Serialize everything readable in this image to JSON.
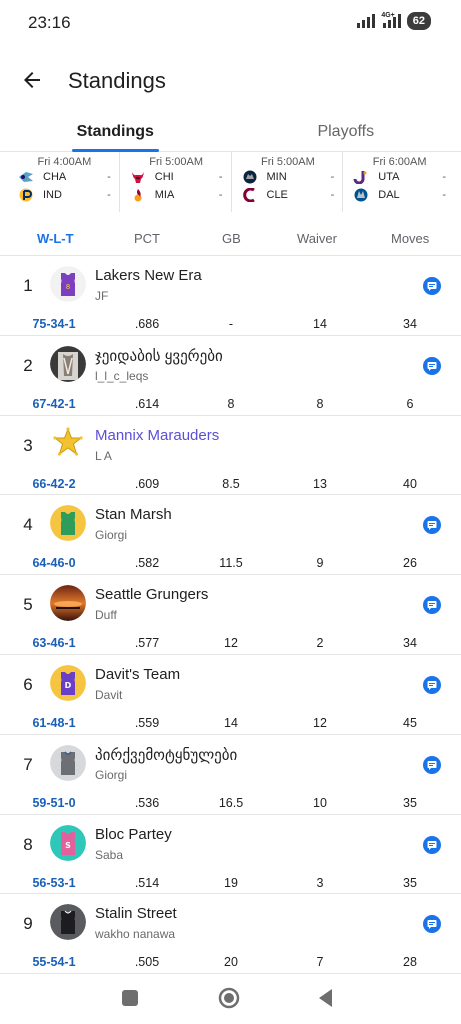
{
  "status": {
    "time": "23:16",
    "network": "4G+",
    "battery": "62"
  },
  "header": {
    "title": "Standings"
  },
  "tabs": [
    {
      "label": "Standings",
      "active": true
    },
    {
      "label": "Playoffs",
      "active": false
    }
  ],
  "games": [
    {
      "time": "Fri 4:00AM",
      "teams": [
        {
          "abbr": "CHA",
          "score": "-",
          "logo": "hornets-logo"
        },
        {
          "abbr": "IND",
          "score": "-",
          "logo": "pacers-logo"
        }
      ]
    },
    {
      "time": "Fri 5:00AM",
      "teams": [
        {
          "abbr": "CHI",
          "score": "-",
          "logo": "bulls-logo"
        },
        {
          "abbr": "MIA",
          "score": "-",
          "logo": "heat-logo"
        }
      ]
    },
    {
      "time": "Fri 5:00AM",
      "teams": [
        {
          "abbr": "MIN",
          "score": "-",
          "logo": "timberwolves-logo"
        },
        {
          "abbr": "CLE",
          "score": "-",
          "logo": "cavaliers-logo"
        }
      ]
    },
    {
      "time": "Fri 6:00AM",
      "teams": [
        {
          "abbr": "UTA",
          "score": "-",
          "logo": "jazz-logo"
        },
        {
          "abbr": "DAL",
          "score": "-",
          "logo": "mavericks-logo"
        }
      ]
    }
  ],
  "columns": {
    "wlt": "W-L-T",
    "pct": "PCT",
    "gb": "GB",
    "waiver": "Waiver",
    "moves": "Moves"
  },
  "standings": [
    {
      "rank": "1",
      "team": "Lakers New Era",
      "owner": "JF",
      "wlt": "75-34-1",
      "pct": ".686",
      "gb": "-",
      "waiver": "14",
      "moves": "34",
      "avatar": "purple-jersey",
      "chat": true
    },
    {
      "rank": "2",
      "team": "ჯეიდაბის ყვერები",
      "owner": "l_l_c_leqs",
      "wlt": "67-42-1",
      "pct": ".614",
      "gb": "8",
      "waiver": "8",
      "moves": "6",
      "avatar": "photo-avatar",
      "chat": true
    },
    {
      "rank": "3",
      "team": "Mannix Marauders",
      "owner": "L A",
      "wlt": "66-42-2",
      "pct": ".609",
      "gb": "8.5",
      "waiver": "13",
      "moves": "40",
      "avatar": "sheriff-star",
      "chat": false,
      "highlight": true
    },
    {
      "rank": "4",
      "team": "Stan Marsh",
      "owner": "Giorgi",
      "wlt": "64-46-0",
      "pct": ".582",
      "gb": "11.5",
      "waiver": "9",
      "moves": "26",
      "avatar": "green-jersey",
      "chat": true
    },
    {
      "rank": "5",
      "team": "Seattle Grungers",
      "owner": "Duff",
      "wlt": "63-46-1",
      "pct": ".577",
      "gb": "12",
      "waiver": "2",
      "moves": "34",
      "avatar": "sunset-photo",
      "chat": true
    },
    {
      "rank": "6",
      "team": "Davit's Team",
      "owner": "Davit",
      "wlt": "61-48-1",
      "pct": ".559",
      "gb": "14",
      "waiver": "12",
      "moves": "45",
      "avatar": "d-jersey",
      "chat": true
    },
    {
      "rank": "7",
      "team": "პირქვემოტყნულები",
      "owner": "Giorgi",
      "wlt": "59-51-0",
      "pct": ".536",
      "gb": "16.5",
      "waiver": "10",
      "moves": "35",
      "avatar": "grey-jersey",
      "chat": true
    },
    {
      "rank": "8",
      "team": "Bloc Partey",
      "owner": "Saba",
      "wlt": "56-53-1",
      "pct": ".514",
      "gb": "19",
      "waiver": "3",
      "moves": "35",
      "avatar": "s-jersey",
      "chat": true
    },
    {
      "rank": "9",
      "team": "Stalin Street",
      "owner": "wakho nanawa",
      "wlt": "55-54-1",
      "pct": ".505",
      "gb": "20",
      "waiver": "7",
      "moves": "28",
      "avatar": "dark-jersey",
      "chat": true
    }
  ],
  "colors": {
    "accent": "#1a73e8",
    "wlt": "#1a5fb8",
    "highlight": "#5b4fd8",
    "chat": "#1a73e8"
  },
  "nav": [
    {
      "icon": "square-recents-icon"
    },
    {
      "icon": "circle-home-icon"
    },
    {
      "icon": "triangle-back-icon"
    }
  ]
}
